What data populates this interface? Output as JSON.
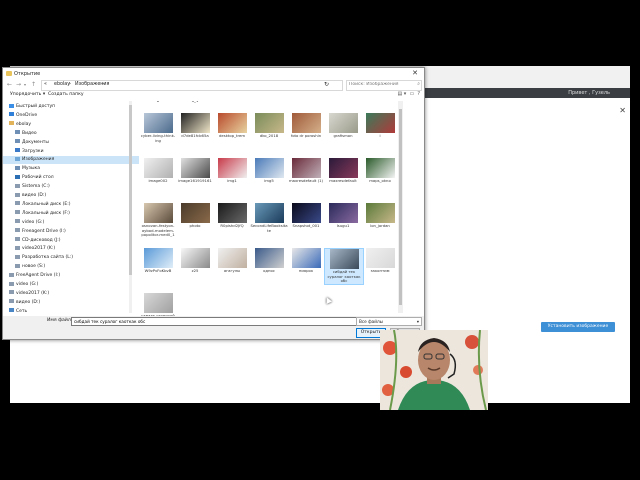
{
  "browser": {
    "right_text": "Привет , Гузель",
    "close": "✕",
    "action_button": "Установить изображение профиля"
  },
  "dialog": {
    "title": "Открытие",
    "close": "✕",
    "address": {
      "crumbs": [
        "«",
        "ebolay",
        "›",
        "Изображения",
        "›"
      ],
      "refresh": "↻"
    },
    "search_placeholder": "Поиск: Изображения",
    "toolbar": {
      "organize": "Упорядочить ▾",
      "new_folder": "Создать папку"
    },
    "nav_items": [
      {
        "label": "Быстрый доступ",
        "color": "#3a8ee6",
        "indent": 0
      },
      {
        "label": "OneDrive",
        "color": "#2f7fd8",
        "indent": 0
      },
      {
        "label": "ebolay",
        "color": "#e3b35a",
        "indent": 0
      },
      {
        "label": "Видео",
        "color": "#6f8fb4",
        "indent": 1
      },
      {
        "label": "Документы",
        "color": "#6f8fb4",
        "indent": 1
      },
      {
        "label": "Загрузки",
        "color": "#3a79c8",
        "indent": 1
      },
      {
        "label": "Изображения",
        "color": "#6fa7d8",
        "indent": 1,
        "selected": true
      },
      {
        "label": "Музыка",
        "color": "#6f8fb4",
        "indent": 1
      },
      {
        "label": "Рабочий стол",
        "color": "#2d6fb3",
        "indent": 1
      },
      {
        "label": "Sistema (C:)",
        "color": "#8a9bb0",
        "indent": 1
      },
      {
        "label": "видео (D:)",
        "color": "#8a9bb0",
        "indent": 1
      },
      {
        "label": "Локальный диск (E:)",
        "color": "#8a9bb0",
        "indent": 1
      },
      {
        "label": "Локальный диск (F:)",
        "color": "#8a9bb0",
        "indent": 1
      },
      {
        "label": "video (G:)",
        "color": "#8a9bb0",
        "indent": 1
      },
      {
        "label": "Freeagent Drive (I:)",
        "color": "#8a9bb0",
        "indent": 1
      },
      {
        "label": "CD-дисковод (J:)",
        "color": "#8a9bb0",
        "indent": 1
      },
      {
        "label": "video2017 (K:)",
        "color": "#8a9bb0",
        "indent": 1
      },
      {
        "label": "Разработка сайта (L:)",
        "color": "#8a9bb0",
        "indent": 1
      },
      {
        "label": "новое (S:)",
        "color": "#8a9bb0",
        "indent": 1
      },
      {
        "label": "FreeAgent Drive (I:)",
        "color": "#8a9bb0",
        "indent": 0
      },
      {
        "label": "video (G:)",
        "color": "#8a9bb0",
        "indent": 0
      },
      {
        "label": "video2017 (K:)",
        "color": "#8a9bb0",
        "indent": 0
      },
      {
        "label": "видео (D:)",
        "color": "#8a9bb0",
        "indent": 0
      },
      {
        "label": "Сеть",
        "color": "#4a86c5",
        "indent": 0
      }
    ],
    "files": [
      {
        "caption": "c8acd086275054a6b",
        "c1": "#f4f4f4",
        "c2": "#ffffff"
      },
      {
        "caption": "dcbdfe78ad7cf184f6_1",
        "c1": "#f4f4f4",
        "c2": "#ffffff"
      },
      {
        "caption": "",
        "c1": "#ffffff",
        "c2": "#ffffff"
      },
      {
        "caption": "",
        "c1": "#ffffff",
        "c2": "#ffffff"
      },
      {
        "caption": "",
        "c1": "#ffffff",
        "c2": "#ffffff"
      },
      {
        "caption": "",
        "c1": "#ffffff",
        "c2": "#ffffff"
      },
      {
        "caption": "",
        "c1": "#ffffff",
        "c2": "#ffffff"
      },
      {
        "caption": "cyber-living-think-ing",
        "c1": "#b8c7d8",
        "c2": "#4b6a8c"
      },
      {
        "caption": "d7de81fcb65a",
        "c1": "#222222",
        "c2": "#f0e6c8"
      },
      {
        "caption": "desktop_trem",
        "c1": "#b84a2c",
        "c2": "#e8d3a0"
      },
      {
        "caption": "dko_2018",
        "c1": "#7a8c5a",
        "c2": "#c8b88a"
      },
      {
        "caption": "foto dr poroshin",
        "c1": "#a05a3a",
        "c2": "#d4b08a"
      },
      {
        "caption": "grafismon",
        "c1": "#d8d8d0",
        "c2": "#9a9a8a"
      },
      {
        "caption": "i",
        "c1": "#3a7a5a",
        "c2": "#b03a3a"
      },
      {
        "caption": "image002",
        "c1": "#f0f0f0",
        "c2": "#b0b0b0"
      },
      {
        "caption": "image161919161",
        "c1": "#e0e0e0",
        "c2": "#4a4a4a"
      },
      {
        "caption": "img1",
        "c1": "#c83a4a",
        "c2": "#f0f0f0"
      },
      {
        "caption": "img5",
        "c1": "#4a7ab8",
        "c2": "#dfe8f0"
      },
      {
        "caption": "maxresdefault (1)",
        "c1": "#6a2a3a",
        "c2": "#c0b0b8"
      },
      {
        "caption": "maxresdefault",
        "c1": "#2a1a3a",
        "c2": "#8a3a5a"
      },
      {
        "caption": "maps_okno",
        "c1": "#2a5a2a",
        "c2": "#f4f4f4"
      },
      {
        "caption": "osnovan-festyon-aybod-modelem-popolitor-med0_1",
        "c1": "#d8c8b0",
        "c2": "#5a4a3a"
      },
      {
        "caption": "photo",
        "c1": "#4a3a2a",
        "c2": "#8a6a4a"
      },
      {
        "caption": "R0pishd2JfQ",
        "c1": "#1a1a1a",
        "c2": "#6a6a6a"
      },
      {
        "caption": "SecondLifeBooksitate",
        "c1": "#6a9ab8",
        "c2": "#1a3a5a"
      },
      {
        "caption": "Snapshot_001",
        "c1": "#0a0a1a",
        "c2": "#3a4a8a"
      },
      {
        "caption": "Isugu1",
        "c1": "#2a2a5a",
        "c2": "#8a6aa0"
      },
      {
        "caption": "lon_jordan",
        "c1": "#5a7a3a",
        "c2": "#c8b88a"
      },
      {
        "caption": "W9zPvFoKbvB",
        "c1": "#5a9ad8",
        "c2": "#e0eef8"
      },
      {
        "caption": "z25",
        "c1": "#f8f8f8",
        "c2": "#8a8a8a"
      },
      {
        "caption": "агагулы",
        "c1": "#f0f0f0",
        "c2": "#c0b0a0"
      },
      {
        "caption": "однос",
        "c1": "#3a5a8a",
        "c2": "#d0d0d0"
      },
      {
        "caption": "пиярок",
        "c1": "#e8e8e8",
        "c2": "#3a6ab8"
      },
      {
        "caption": "сибдай тек суралог каоткак обс",
        "c1": "#a8b8c8",
        "c2": "#3a4a5a",
        "selected": true
      },
      {
        "caption": "законтим",
        "c1": "#f0f0f0",
        "c2": "#d8d8d8"
      },
      {
        "caption": "гамзак сезнорой",
        "c1": "#d8d8d8",
        "c2": "#a0a0a0"
      }
    ],
    "filename_label": "Имя файла:",
    "filename_value": "сибдай тек суралог каоткак обс",
    "filter": {
      "value": "Все файлы",
      "arrow": "▾"
    },
    "open": "Открыть",
    "cancel": "Отмена"
  }
}
